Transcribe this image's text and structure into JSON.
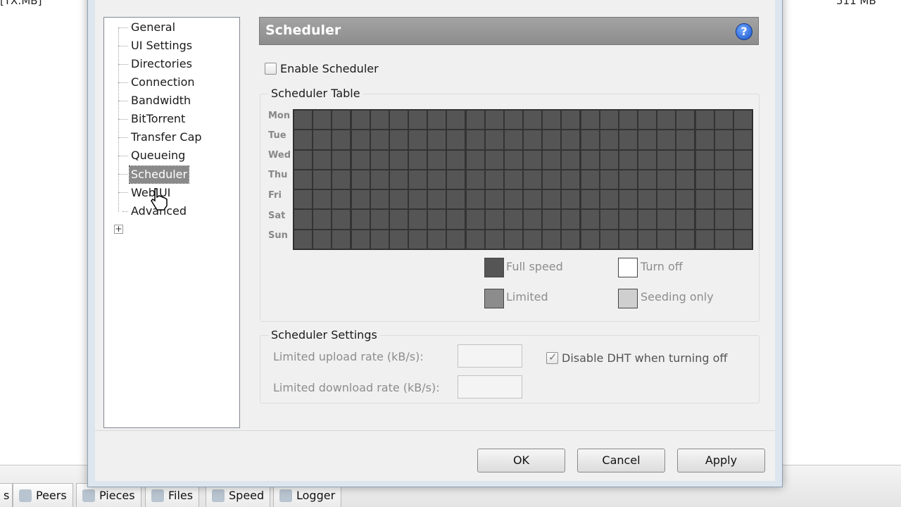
{
  "background": {
    "top_left_text": "[TX:MB]",
    "top_right_text": "511 MB",
    "tabs": [
      {
        "label": "s",
        "icon": "tab-icon"
      },
      {
        "label": "Peers",
        "icon": "peers-icon"
      },
      {
        "label": "Pieces",
        "icon": "pieces-icon"
      },
      {
        "label": "Files",
        "icon": "files-icon"
      },
      {
        "label": "Speed",
        "icon": "speed-icon"
      },
      {
        "label": "Logger",
        "icon": "logger-icon"
      }
    ]
  },
  "tree": {
    "items": [
      "General",
      "UI Settings",
      "Directories",
      "Connection",
      "Bandwidth",
      "BitTorrent",
      "Transfer Cap",
      "Queueing",
      "Scheduler",
      "Web UI",
      "Advanced"
    ],
    "selected": "Scheduler"
  },
  "header": {
    "title": "Scheduler",
    "help_icon": "?"
  },
  "enable_scheduler": {
    "label": "Enable Scheduler",
    "checked": false
  },
  "scheduler_table": {
    "title": "Scheduler Table",
    "days": [
      "Mon",
      "Tue",
      "Wed",
      "Thu",
      "Fri",
      "Sat",
      "Sun"
    ],
    "hours_per_day": 24,
    "cell_color": "#555555",
    "legend": [
      {
        "label": "Full speed",
        "color": "#555555"
      },
      {
        "label": "Turn off",
        "color": "#ffffff"
      },
      {
        "label": "Limited",
        "color": "#8c8c8c"
      },
      {
        "label": "Seeding only",
        "color": "#cfcfcf"
      }
    ]
  },
  "scheduler_settings": {
    "title": "Scheduler Settings",
    "upload_label": "Limited upload rate (kB/s):",
    "upload_value": "",
    "download_label": "Limited download rate (kB/s):",
    "download_value": "",
    "dht_label": "Disable DHT when turning off",
    "dht_checked": true
  },
  "buttons": {
    "ok": "OK",
    "cancel": "Cancel",
    "apply": "Apply"
  }
}
